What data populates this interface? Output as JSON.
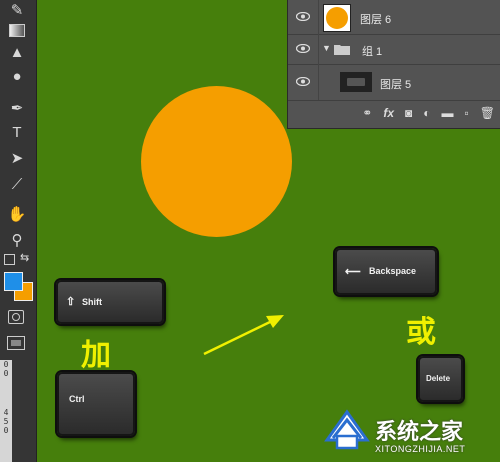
{
  "layers": [
    {
      "name": "图层 6"
    },
    {
      "name": "组 1"
    },
    {
      "name": "图层 5"
    }
  ],
  "panel_footer": {
    "fx_label": "fx"
  },
  "ruler": {
    "labels": [
      "0",
      "0",
      "",
      "4",
      "5",
      "0"
    ]
  },
  "keys": {
    "shift": "Shift",
    "ctrl": "Ctrl",
    "backspace": "Backspace",
    "delete": "Delete"
  },
  "text": {
    "and": "加",
    "or": "或"
  },
  "watermark": {
    "brand": "系统之家",
    "url": "XITONGZHIJIA.NET"
  },
  "colors": {
    "background": "#467f0c",
    "circle": "#f59e00",
    "foreground_swatch": "#1f8fe8",
    "background_swatch": "#f59e00",
    "annotation": "#f0f000"
  },
  "icons": [
    "brush-icon",
    "gradient-icon",
    "blur-icon",
    "dodge-icon",
    "pen-icon",
    "type-icon",
    "path-selection-icon",
    "line-icon",
    "hand-icon",
    "zoom-icon",
    "eye-icon",
    "folder-icon",
    "link-icon",
    "adjustment-icon",
    "mask-icon",
    "new-layer-icon",
    "trash-icon"
  ]
}
